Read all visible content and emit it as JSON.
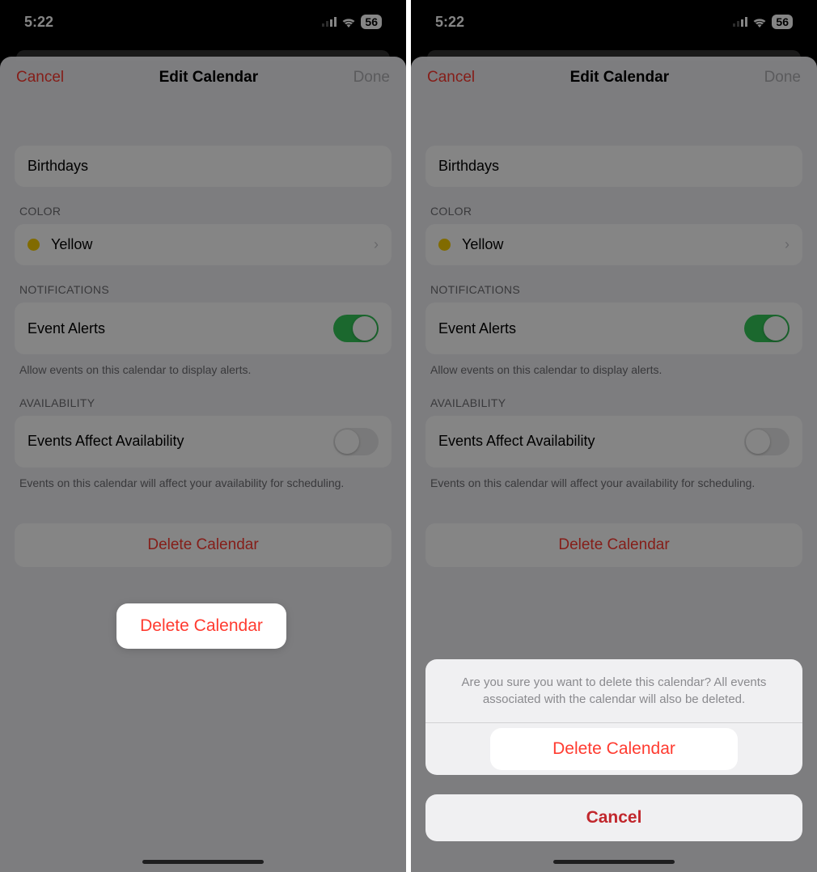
{
  "status": {
    "time": "5:22",
    "battery": "56"
  },
  "nav": {
    "cancel": "Cancel",
    "title": "Edit Calendar",
    "done": "Done"
  },
  "name": {
    "value": "Birthdays"
  },
  "color": {
    "header": "COLOR",
    "label": "Yellow",
    "hex": "#f7ce00"
  },
  "notifications": {
    "header": "NOTIFICATIONS",
    "label": "Event Alerts",
    "footer": "Allow events on this calendar to display alerts."
  },
  "availability": {
    "header": "AVAILABILITY",
    "label": "Events Affect Availability",
    "footer": "Events on this calendar will affect your availability for scheduling."
  },
  "delete": {
    "label": "Delete Calendar"
  },
  "confirm": {
    "message": "Are you sure you want to delete this calendar? All events associated with the calendar will also be deleted.",
    "delete": "Delete Calendar",
    "cancel": "Cancel"
  }
}
